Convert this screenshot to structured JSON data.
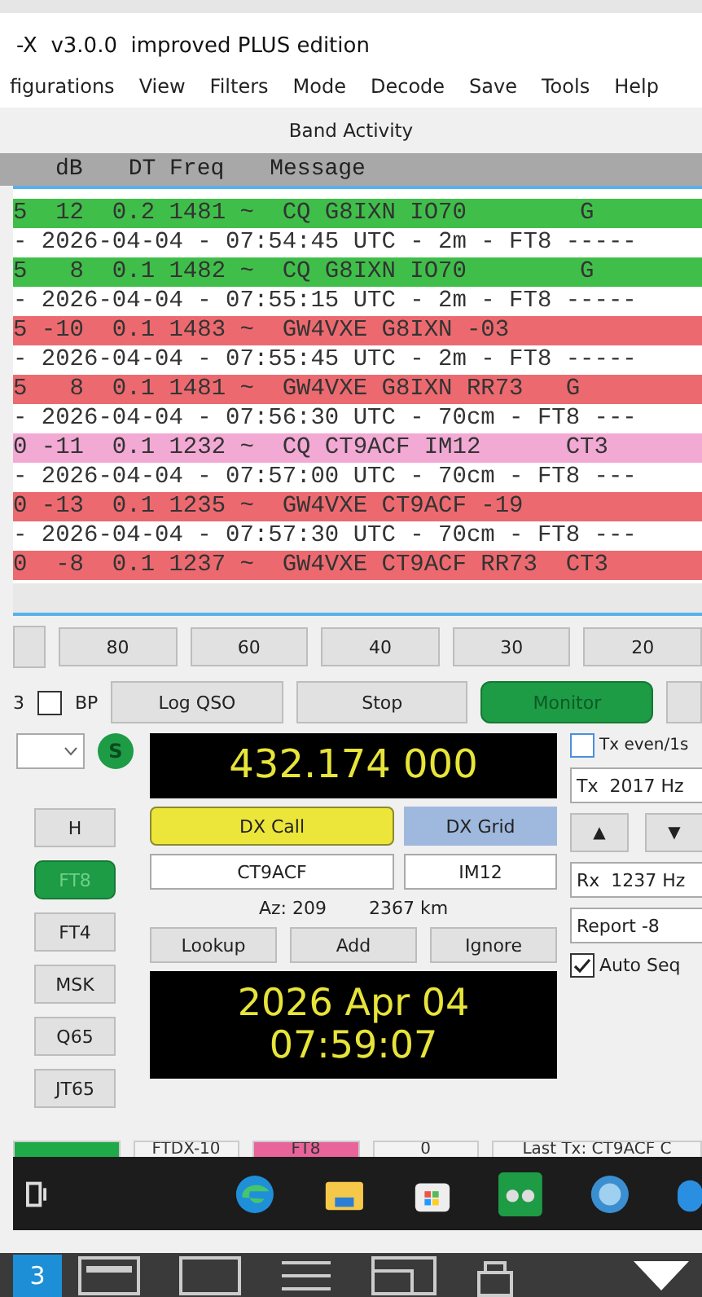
{
  "window": {
    "title": "-X  v3.0.0  improved PLUS edition"
  },
  "menu": [
    "figurations",
    "View",
    "Filters",
    "Mode",
    "Decode",
    "Save",
    "Tools",
    "Help"
  ],
  "panel_title": "Band Activity",
  "columns": [
    "dB",
    "DT Freq",
    "Message"
  ],
  "rows": [
    {
      "kind": "decode",
      "color": "#3fbf4a",
      "text": "5  12  0.2 1481 ~  CQ G8IXN IO70        G"
    },
    {
      "kind": "separator",
      "text": "- 2026-04-04 - 07:54:45 UTC - 2m - FT8 -----"
    },
    {
      "kind": "decode",
      "color": "#3fbf4a",
      "text": "5   8  0.1 1482 ~  CQ G8IXN IO70        G"
    },
    {
      "kind": "separator",
      "text": "- 2026-04-04 - 07:55:15 UTC - 2m - FT8 -----"
    },
    {
      "kind": "decode",
      "color": "#ec6a6f",
      "text": "5 -10  0.1 1483 ~  GW4VXE G8IXN -03"
    },
    {
      "kind": "separator",
      "text": "- 2026-04-04 - 07:55:45 UTC - 2m - FT8 -----"
    },
    {
      "kind": "decode",
      "color": "#ec6a6f",
      "text": "5   8  0.1 1481 ~  GW4VXE G8IXN RR73   G"
    },
    {
      "kind": "separator",
      "text": "- 2026-04-04 - 07:56:30 UTC - 70cm - FT8 ---"
    },
    {
      "kind": "decode",
      "color": "#f2a9d4",
      "text": "0 -11  0.1 1232 ~  CQ CT9ACF IM12      CT3"
    },
    {
      "kind": "separator",
      "text": "- 2026-04-04 - 07:57:00 UTC - 70cm - FT8 ---"
    },
    {
      "kind": "decode",
      "color": "#ec6a6f",
      "text": "0 -13  0.1 1235 ~  GW4VXE CT9ACF -19"
    },
    {
      "kind": "separator",
      "text": "- 2026-04-04 - 07:57:30 UTC - 70cm - FT8 ---"
    },
    {
      "kind": "decode",
      "color": "#ec6a6f",
      "text": "0  -8  0.1 1237 ~  GW4VXE CT9ACF RR73  CT3"
    }
  ],
  "bands": [
    "80",
    "60",
    "40",
    "30",
    "20"
  ],
  "prefix": "3",
  "bp": {
    "label": "BP",
    "checked": false
  },
  "actions": [
    {
      "label": "Log QSO",
      "on": false
    },
    {
      "label": "Stop",
      "on": false
    },
    {
      "label": "Monitor",
      "on": true
    }
  ],
  "s_badge": "S",
  "frequency": "432.174 000",
  "tx_even": {
    "label": "Tx even/1s",
    "checked": false
  },
  "tx_freq": "Tx  2017 Hz",
  "rx_freq": "Rx  1237 Hz",
  "arrows": [
    "▲",
    "▼"
  ],
  "report": "Report -8",
  "auto_seq": {
    "label": "Auto Seq",
    "checked": true
  },
  "dx_call_label": "DX Call",
  "dx_grid_label": "DX Grid",
  "dx_call": "CT9ACF",
  "dx_grid": "IM12",
  "azimuth": "Az: 209",
  "distance": "2367 km",
  "lookup_buttons": [
    "Lookup",
    "Add",
    "Ignore"
  ],
  "modes": [
    {
      "label": "H",
      "selected": false
    },
    {
      "label": "FT8",
      "selected": true
    },
    {
      "label": "FT4",
      "selected": false
    },
    {
      "label": "MSK",
      "selected": false
    },
    {
      "label": "Q65",
      "selected": false
    },
    {
      "label": "JT65",
      "selected": false
    }
  ],
  "clock": {
    "date": "2026 Apr 04",
    "time": "07:59:07"
  },
  "status": [
    {
      "color": "#1faa4a"
    },
    {
      "text": "FTDX-10",
      "color": "#f3f3f3"
    },
    {
      "text": "FT8",
      "color": "#e8649a"
    },
    {
      "text": "0",
      "color": "#f3f3f3"
    },
    {
      "text": "Last Tx: CT9ACF C",
      "color": "#f3f3f3"
    }
  ],
  "desktop_number": "3"
}
